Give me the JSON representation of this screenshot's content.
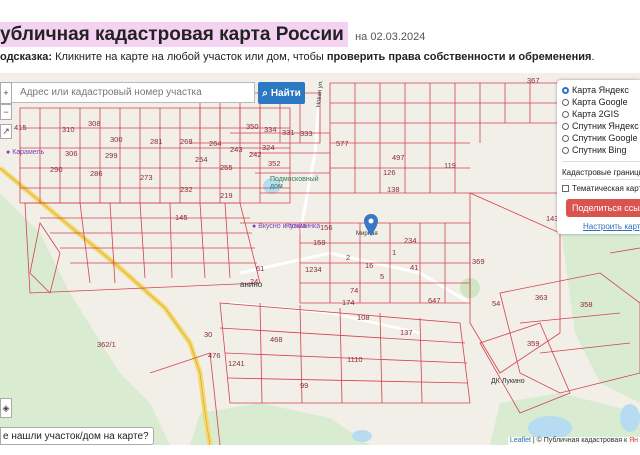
{
  "header": {
    "title": "убличная кадастровая карта России",
    "date": "на 02.03.2024"
  },
  "hint": {
    "prefix": "одсказка:",
    "text": " Кликните на карте на любой участок или дом, чтобы ",
    "bold": "проверить права собственности и обременения",
    "suffix": "."
  },
  "search": {
    "placeholder": "Адрес или кадастровый номер участка",
    "button_label": "Найти"
  },
  "layers": {
    "base_maps": [
      {
        "label": "Карта Яндекс",
        "selected": true
      },
      {
        "label": "Карта Google",
        "selected": false
      },
      {
        "label": "Карта 2GIS",
        "selected": false
      },
      {
        "label": "Спутник Яндекс",
        "selected": false
      },
      {
        "label": "Спутник Google",
        "selected": false
      },
      {
        "label": "Спутник Bing",
        "selected": false
      }
    ],
    "cadastral_label": "Кадастровые границы",
    "thematic_label": "Тематическая карта",
    "share_label": "Поделиться ссылкой",
    "configure_label": "Настроить карту"
  },
  "footer": {
    "not_found": "е нашли участок/дом на карте?",
    "leaflet": "Leaflet",
    "attribution": " | © Публичная кадастровая к",
    "yandex_mark": "Ян"
  },
  "map_labels": {
    "karamel": "Карамель",
    "podmoskovny_dom": "Подмосковный дом",
    "vkusno": "Вкусно и точка",
    "kuzminka": "Кузьминка",
    "shchanino": "анино",
    "novaya_street": "Новая ул.",
    "dk_lukino": "ДК Лукино",
    "mirnaya": "Мирная"
  },
  "parcels": [
    "367",
    "415",
    "310",
    "308",
    "300",
    "281",
    "268",
    "264",
    "243",
    "242",
    "306",
    "299",
    "254",
    "255",
    "290",
    "286",
    "273",
    "232",
    "219",
    "350",
    "334",
    "331",
    "333",
    "324",
    "352",
    "577",
    "497",
    "119",
    "126",
    "138",
    "369",
    "363",
    "358",
    "359",
    "362/1",
    "61",
    "1234",
    "1110",
    "1241",
    "476",
    "468",
    "54",
    "74",
    "159",
    "234",
    "1",
    "16",
    "2",
    "5",
    "41",
    "647",
    "24",
    "30",
    "99",
    "143",
    "174",
    "108",
    "137",
    "156",
    "145"
  ],
  "colors": {
    "parcel_stroke": "#d2424f",
    "forest": "#d9ecd1",
    "water": "#b7dcf2",
    "road": "#f7d86a",
    "find_button": "#2b78c3",
    "share_button": "#d9534f",
    "title_highlight": "#f4d3f2"
  }
}
